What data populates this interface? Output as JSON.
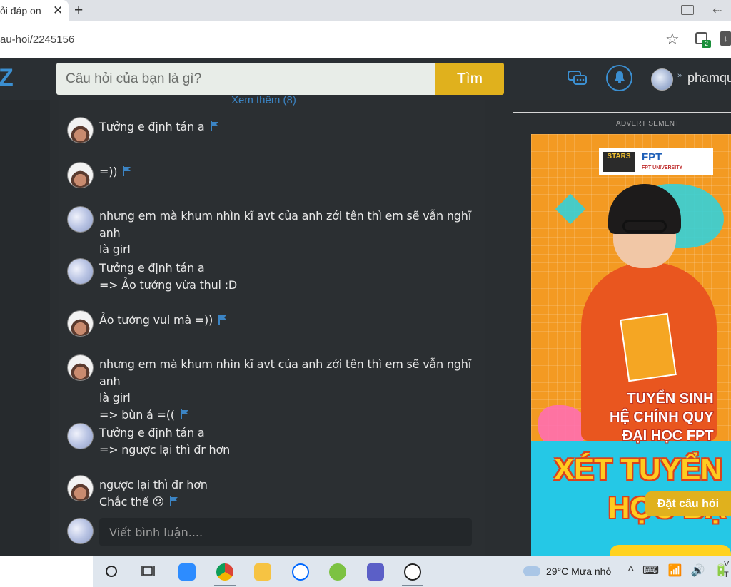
{
  "browser": {
    "tab_title": "ỏi đáp on",
    "tab_close": "✕",
    "new_tab": "+",
    "url": "au-hoi/2245156",
    "extension_badge": "2"
  },
  "header": {
    "search_placeholder": "Câu hỏi của bạn là gì?",
    "search_button": "Tìm",
    "username": "phamqu",
    "logo_char": "Z",
    "colors": {
      "accent": "#3b8fd1",
      "button": "#e0b11d"
    }
  },
  "comments": {
    "see_more": "Xem thêm (8)",
    "items": [
      {
        "avatar": "girl",
        "lines": [
          "Tưởng e định tán a"
        ],
        "flag": true
      },
      {
        "avatar": "girl",
        "lines": [
          "=))"
        ],
        "flag": true
      },
      {
        "avatar": "blur",
        "lines": [
          "nhưng em mà khum nhìn kĩ avt của anh zới tên thì em sẽ vẫn nghĩ anh",
          "là girl"
        ],
        "flag": false
      },
      {
        "avatar": "blur",
        "lines": [
          "Tưởng e định tán a",
          "=> Ảo tưởng vừa thui :D"
        ],
        "flag": false
      },
      {
        "avatar": "girl",
        "lines": [
          "Ảo tưởng vui mà =))"
        ],
        "flag": true
      },
      {
        "avatar": "girl",
        "lines": [
          "nhưng em mà khum nhìn kĩ avt của anh zới tên thì em sẽ vẫn nghĩ anh",
          "là girl",
          "=> bùn á =(("
        ],
        "flag": true
      },
      {
        "avatar": "blur",
        "lines": [
          "Tưởng e định tán a",
          "=> ngược lại thì đr hơn"
        ],
        "flag": false
      },
      {
        "avatar": "girl",
        "lines": [
          "ngược lại thì đr hơn",
          "Chắc thế 😕"
        ],
        "flag": true
      }
    ],
    "reply_placeholder": "Viết bình luận...."
  },
  "sidebar": {
    "ad_label": "ADVERTISEMENT",
    "ad": {
      "logo_stars": "STARS",
      "logo_fpt": "FPT",
      "logo_fpt_sub": "FPT UNIVERSITY",
      "headline": [
        "TUYỂN SINH",
        "HỆ CHÍNH QUY",
        "ĐẠI HỌC FPT"
      ],
      "big_1": "XÉT TUYỂN",
      "big_2": "HỌC BẠ"
    },
    "ask_button": "Đặt câu hỏi"
  },
  "taskbar": {
    "weather": "29°C  Mưa nhỏ",
    "system_tray": "^ ⌨ 📶 🔊 🔋",
    "clock": [
      "V",
      "T"
    ]
  }
}
